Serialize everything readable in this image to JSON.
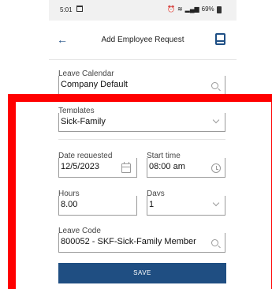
{
  "statusbar": {
    "time": "5:01",
    "battery": "69%"
  },
  "appbar": {
    "back_icon": "arrow-left-icon",
    "title": "Add Employee Request",
    "book_icon": "book-icon"
  },
  "form": {
    "leave_calendar": {
      "label": "Leave Calendar",
      "value": "Company Default",
      "icon": "search-icon"
    },
    "templates": {
      "label": "Templates",
      "value": "Sick-Family",
      "icon": "chevron-down-icon"
    },
    "date_requested": {
      "label": "Date requested",
      "value": "12/5/2023",
      "icon": "calendar-icon"
    },
    "start_time": {
      "label": "Start time",
      "value": "08:00 am",
      "icon": "clock-icon"
    },
    "hours": {
      "label": "Hours",
      "value": "8.00"
    },
    "days": {
      "label": "Days",
      "value": "1",
      "icon": "chevron-down-icon"
    },
    "leave_code": {
      "label": "Leave Code",
      "value": "800052 - SKF-Sick-Family Member",
      "icon": "search-icon"
    }
  },
  "save_label": "SAVE",
  "colors": {
    "primary": "#1f4e82",
    "highlight": "#ff0000"
  }
}
